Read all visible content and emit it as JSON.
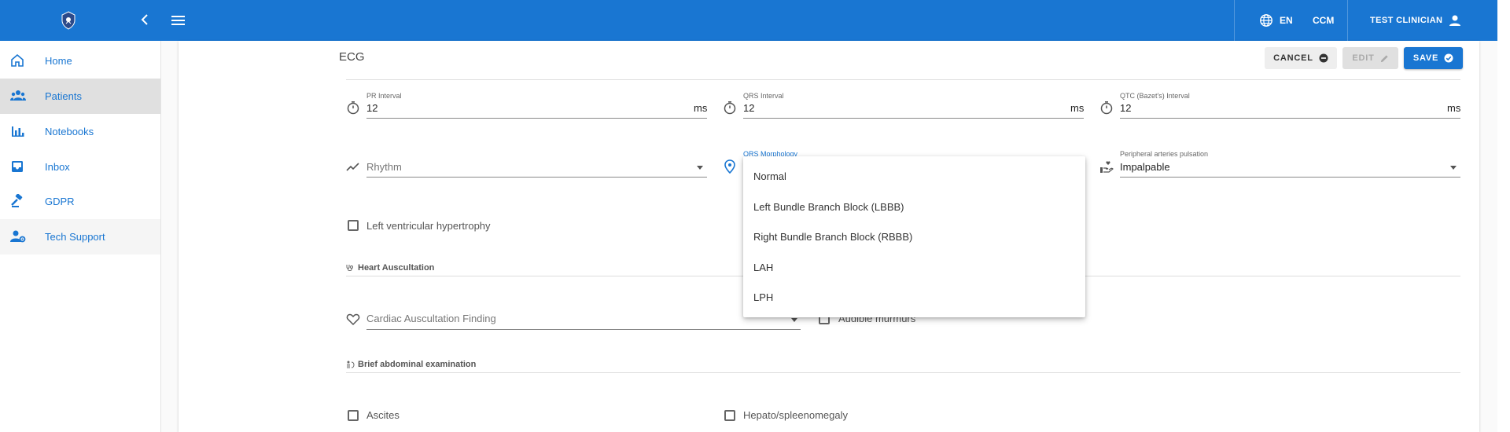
{
  "topbar": {
    "language": "EN",
    "module": "CCM",
    "user_name": "TEST CLINICIAN"
  },
  "sidebar": {
    "items": [
      {
        "label": "Home",
        "icon": "home-icon"
      },
      {
        "label": "Patients",
        "icon": "people-icon"
      },
      {
        "label": "Notebooks",
        "icon": "bar-chart-icon"
      },
      {
        "label": "Inbox",
        "icon": "inbox-icon"
      },
      {
        "label": "GDPR",
        "icon": "gavel-icon"
      },
      {
        "label": "Tech Support",
        "icon": "support-agent-icon"
      }
    ]
  },
  "ecg": {
    "title": "ECG",
    "buttons": {
      "cancel": "CANCEL",
      "edit": "EDIT",
      "save": "SAVE"
    },
    "pr": {
      "label": "PR Interval",
      "value": "12",
      "unit": "ms"
    },
    "qrs": {
      "label": "QRS Interval",
      "value": "12",
      "unit": "ms"
    },
    "qtc": {
      "label": "QTC (Bazet's) Interval",
      "value": "12",
      "unit": "ms"
    },
    "rhythm": {
      "placeholder": "Rhythm"
    },
    "qrs_morphology": {
      "label": "QRS Morphology"
    },
    "peripheral": {
      "label": "Peripheral arteries pulsation",
      "value": "Impalpable"
    },
    "lvh_label": "Left ventricular hypertrophy"
  },
  "heart_auscultation": {
    "title": "Heart Auscultation",
    "finding_placeholder": "Cardiac Auscultation Finding",
    "murmurs_label": "Audible murmurs"
  },
  "abdominal": {
    "title": "Brief abdominal examination",
    "ascites_label": "Ascites",
    "hepato_label": "Hepato/spleenomegaly"
  },
  "dropdown": {
    "options": [
      "Normal",
      "Left Bundle Branch Block (LBBB)",
      "Right Bundle Branch Block (RBBB)",
      "LAH",
      "LPH"
    ]
  },
  "colors": {
    "primary": "#1976d2",
    "active_nav": "#e0e0e0"
  }
}
